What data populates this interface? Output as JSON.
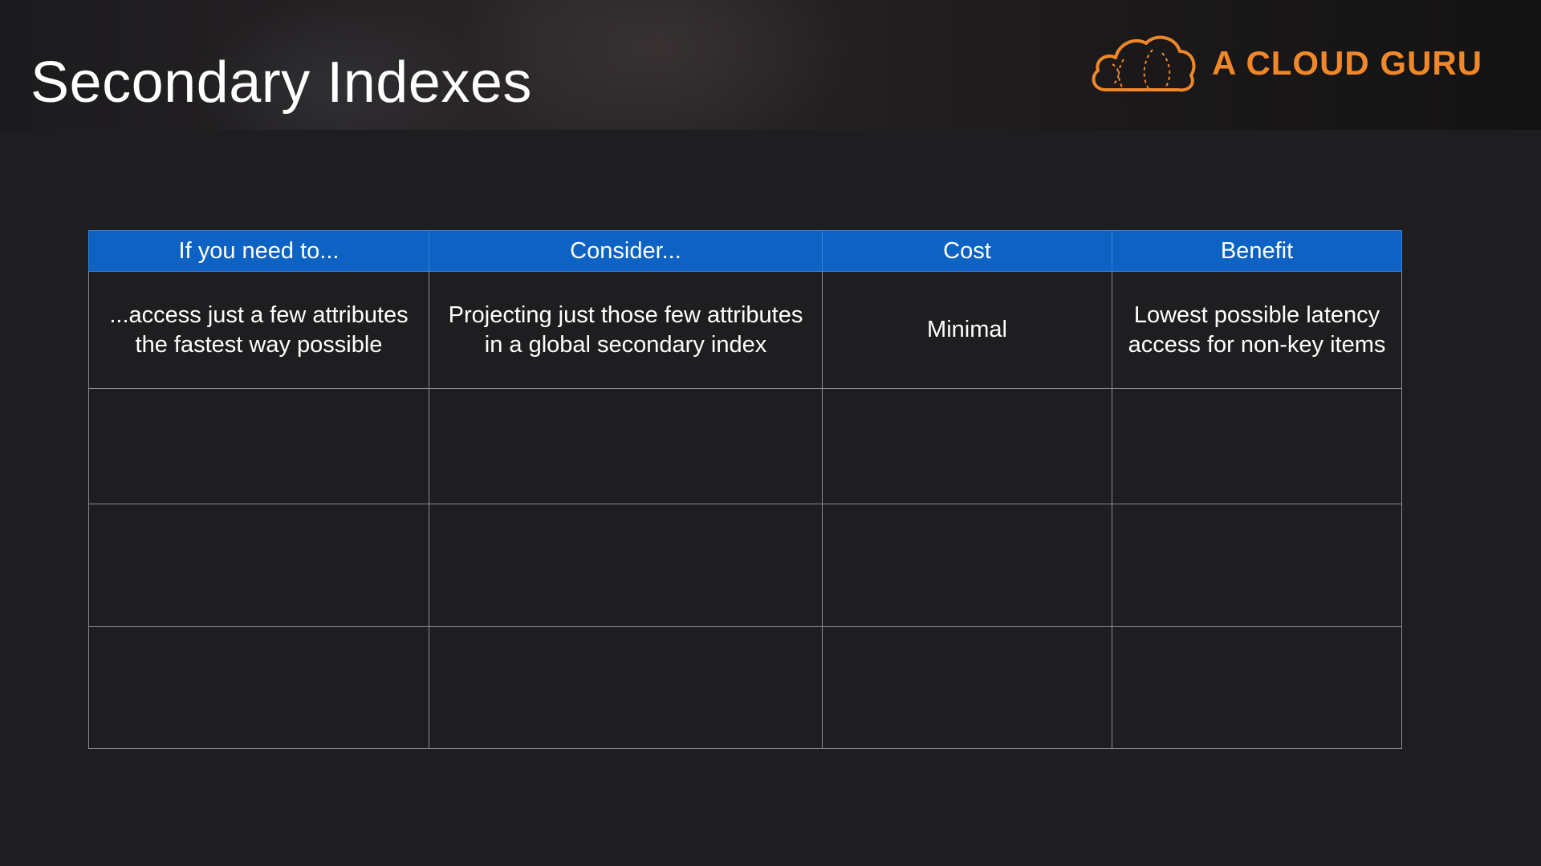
{
  "slide": {
    "title": "Secondary Indexes",
    "logo_text": "A CLOUD GURU",
    "brand_color": "#f0872a",
    "header_color": "#0d62c4"
  },
  "table": {
    "headers": [
      "If you need to...",
      "Consider...",
      "Cost",
      "Benefit"
    ],
    "rows": [
      [
        "...access just a few attributes\nthe fastest way possible",
        "Projecting just those few attributes\nin a global secondary index",
        "Minimal",
        "Lowest possible latency\naccess for non-key items"
      ],
      [
        "",
        "",
        "",
        ""
      ],
      [
        "",
        "",
        "",
        ""
      ],
      [
        "",
        "",
        "",
        ""
      ]
    ]
  }
}
